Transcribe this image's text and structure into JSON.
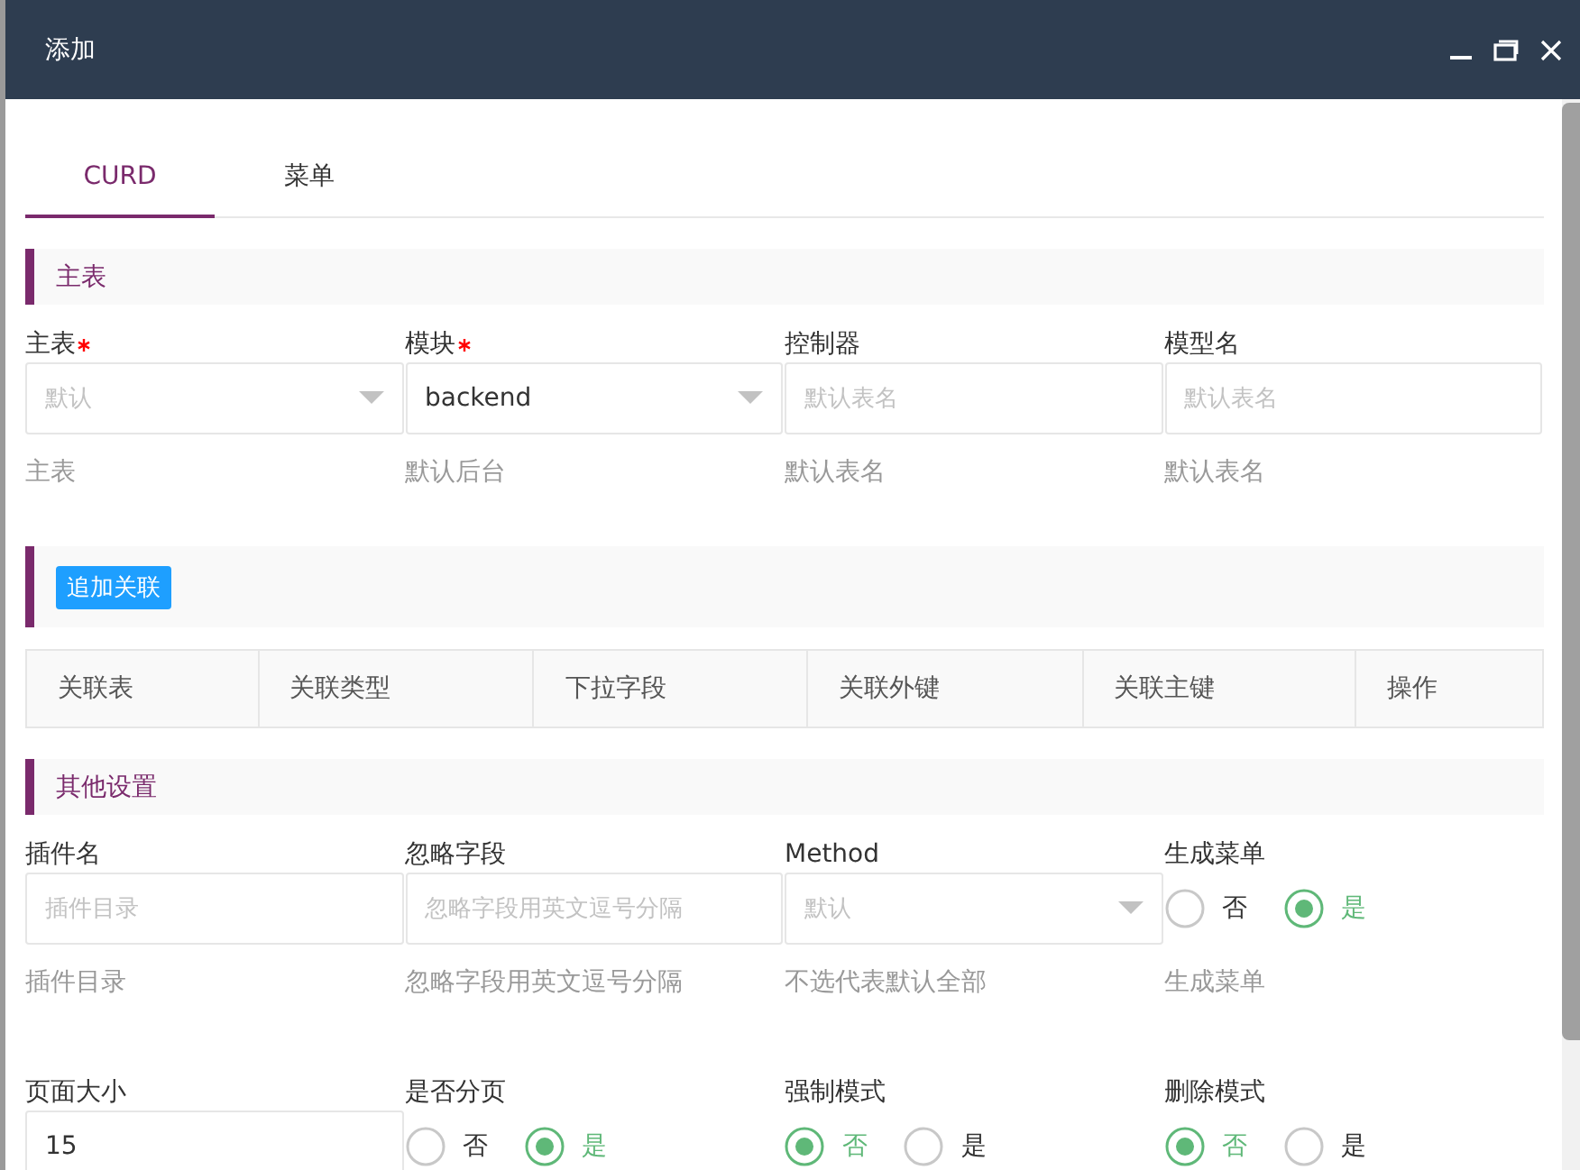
{
  "window": {
    "title": "添加"
  },
  "tabs": [
    {
      "label": "CURD",
      "selected": true
    },
    {
      "label": "菜单",
      "selected": false
    }
  ],
  "sections": [
    {
      "kind": "fields",
      "title": "主表",
      "rows": [
        [
          {
            "kind": "select",
            "label": "主表",
            "required": true,
            "placeholder": "默认",
            "help": "主表"
          },
          {
            "kind": "select",
            "label": "模块",
            "required": true,
            "value": "backend",
            "help": "默认后台"
          },
          {
            "kind": "input",
            "label": "控制器",
            "required": false,
            "placeholder": "默认表名",
            "help": "默认表名"
          },
          {
            "kind": "input",
            "label": "模型名",
            "required": false,
            "placeholder": "默认表名",
            "help": "默认表名"
          }
        ]
      ]
    },
    {
      "kind": "relations",
      "button": "追加关联",
      "columns": [
        "关联表",
        "关联类型",
        "下拉字段",
        "关联外键",
        "关联主键",
        "操作"
      ]
    },
    {
      "kind": "fields",
      "title": "其他设置",
      "rows": [
        [
          {
            "kind": "input",
            "label": "插件名",
            "required": false,
            "placeholder": "插件目录",
            "help": "插件目录"
          },
          {
            "kind": "input",
            "label": "忽略字段",
            "required": false,
            "placeholder": "忽略字段用英文逗号分隔",
            "help": "忽略字段用英文逗号分隔"
          },
          {
            "kind": "select",
            "label": "Method",
            "required": false,
            "placeholder": "默认",
            "help": "不选代表默认全部"
          },
          {
            "kind": "radio",
            "label": "生成菜单",
            "required": false,
            "options": [
              {
                "label": "否",
                "selected": false
              },
              {
                "label": "是",
                "selected": true
              }
            ],
            "help": "生成菜单"
          }
        ],
        [
          {
            "kind": "input",
            "label": "页面大小",
            "required": false,
            "value": "15"
          },
          {
            "kind": "radio",
            "label": "是否分页",
            "required": false,
            "options": [
              {
                "label": "否",
                "selected": false
              },
              {
                "label": "是",
                "selected": true
              }
            ]
          },
          {
            "kind": "radio",
            "label": "强制模式",
            "required": false,
            "options": [
              {
                "label": "否",
                "selected": true
              },
              {
                "label": "是",
                "selected": false
              }
            ]
          },
          {
            "kind": "radio",
            "label": "删除模式",
            "required": false,
            "options": [
              {
                "label": "否",
                "selected": true
              },
              {
                "label": "是",
                "selected": false
              }
            ]
          }
        ]
      ]
    }
  ]
}
